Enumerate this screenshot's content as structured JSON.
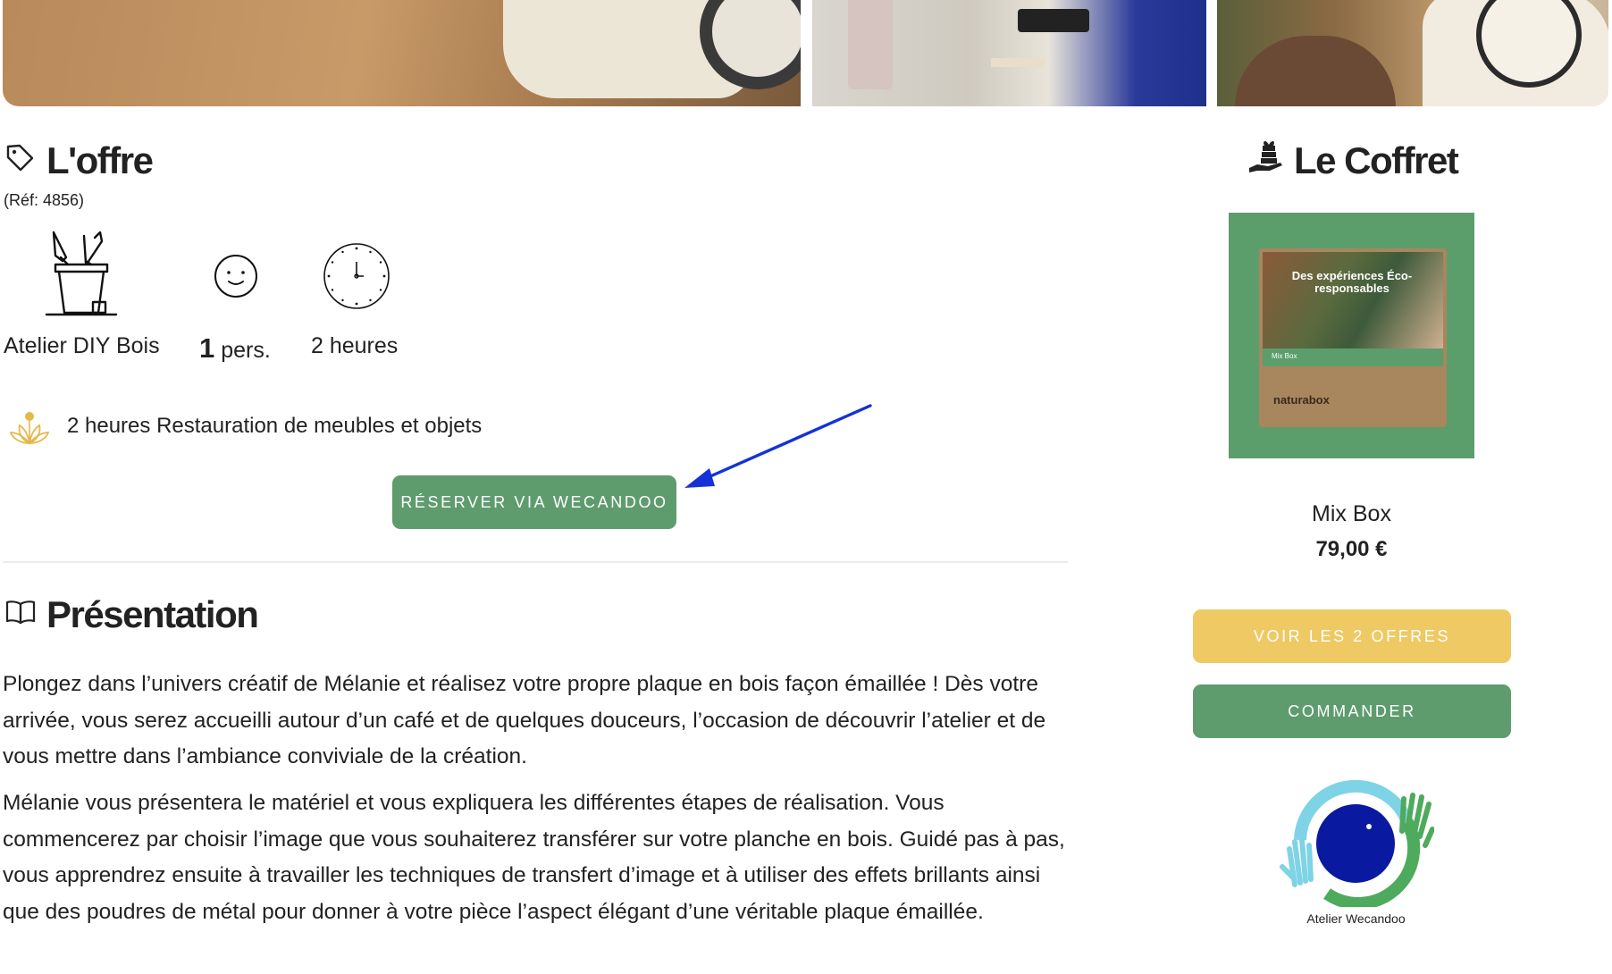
{
  "gallery": {
    "photos": [
      "photo-clock-wood",
      "photo-workshop-table",
      "photo-clock-display"
    ]
  },
  "offer": {
    "title": "L'offre",
    "reference": "(Réf: 4856)",
    "features": [
      {
        "icon": "brush-pot-icon",
        "label": "Atelier DIY Bois"
      },
      {
        "icon": "smiley-icon",
        "count": "1",
        "unit": "pers."
      },
      {
        "icon": "clock-icon",
        "label": "2 heures"
      }
    ],
    "activity_icon": "lotus-icon",
    "activity": "2 heures Restauration de meubles et objets",
    "reserve_button": "RÉSERVER VIA WECANDOO"
  },
  "presentation": {
    "title": "Présentation",
    "paragraphs": [
      "Plongez dans l’univers créatif de Mélanie et réalisez votre propre plaque en bois façon émaillée ! Dès votre arrivée, vous serez accueilli autour d’un café et de quelques douceurs, l’occasion de découvrir l’atelier et de vous mettre dans l’ambiance conviviale de la création.",
      "Mélanie vous présentera le matériel et vous expliquera les différentes étapes de réalisation. Vous commencerez par choisir l’image que vous souhaiterez transférer sur votre planche en bois. Guidé pas à pas, vous apprendrez ensuite à travailler les techniques de transfert d’image et à utiliser des effets brillants ainsi que des poudres de métal pour donner à votre pièce l’aspect élégant d’une véritable plaque émaillée."
    ]
  },
  "coffret": {
    "title": "Le Coffret",
    "box_headline": "Des expériences Éco-responsables",
    "box_label": "Mix Box",
    "box_brand": "naturabox",
    "name": "Mix Box",
    "price": "79,00 €",
    "voir_button": "VOIR LES 2 OFFRES",
    "commander_button": "COMMANDER",
    "partner_logo_text": "Atelier Wecandoo"
  },
  "colors": {
    "green": "#5e9c6e",
    "yellow": "#efc964",
    "arrow": "#1432d8",
    "logo_blue": "#0a1aa0",
    "logo_light": "#7fd3e6"
  }
}
